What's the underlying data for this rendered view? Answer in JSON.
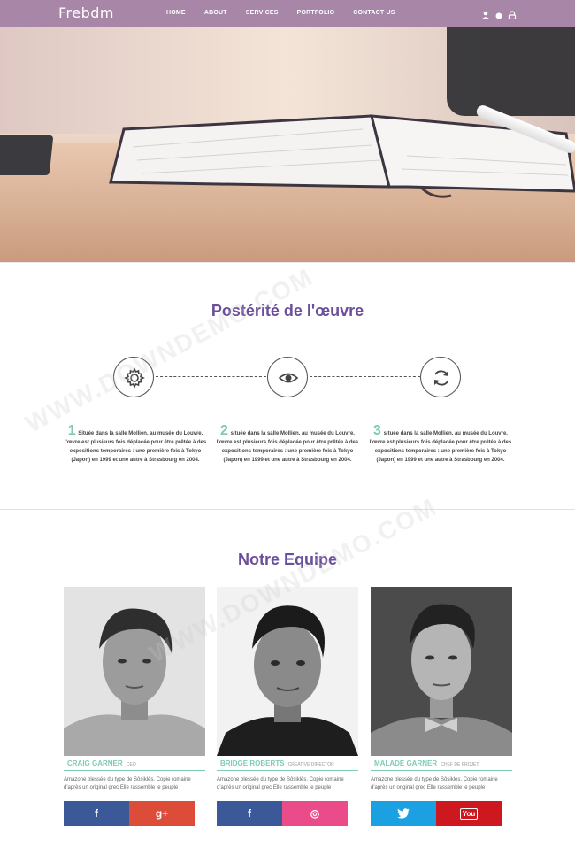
{
  "nav": {
    "logo": "Frebdm",
    "menu": [
      "HOME",
      "ABOUT",
      "SERVICES",
      "PORTFOLIO",
      "CONTACT US"
    ],
    "icons": [
      "user-icon",
      "dot-icon",
      "lock-icon"
    ],
    "bg_color": "#a786a8"
  },
  "hero": {
    "image": "open-notebook-on-desk"
  },
  "process": {
    "title": "Postérité de l'œuvre",
    "icons": [
      "gear-icon",
      "eye-icon",
      "refresh-icon"
    ],
    "steps": [
      {
        "num": "1",
        "text": "Située dans la salle Mollien, au musée du Louvre, l'œvre est plusieurs fois déplacée pour être prêtée à des expositions temporaires : une première fois à Tokyo (Japon) en 1999 et une autre à Strasbourg en 2004."
      },
      {
        "num": "2",
        "text": "située dans la salle Mollien, au musée du Louvre, l'œvre est plusieurs fois déplacée pour être prêtée à des expositions temporaires : une première fois à Tokyo (Japon) en 1999 et une autre à Strasbourg en 2004."
      },
      {
        "num": "3",
        "text": "située dans la salle Mollien, au musée du Louvre, l'œvre est plusieurs fois déplacée pour être prêtée à des expositions temporaires : une première fois à Tokyo (Japon) en 1999 et une autre à Strasbourg en 2004."
      }
    ]
  },
  "team": {
    "title": "Notre Equipe",
    "members": [
      {
        "name": "CRAIG GARNER",
        "role": "CEO",
        "desc": "Amazone blessée du type de Sôsiklès. Copie romaine d'après un original grec Elle rassemble le peuple",
        "socials": [
          {
            "icon": "facebook-icon",
            "label": "f",
            "color": "#3b5998"
          },
          {
            "icon": "google-plus-icon",
            "label": "g+",
            "color": "#dd4b39"
          }
        ]
      },
      {
        "name": "BRIDGE ROBERTS",
        "role": "CREATIVE DIRECTOR",
        "desc": "Amazone blessée du type de Sôsiklès. Copie romaine d'après un original grec Elle rassemble le peuple",
        "socials": [
          {
            "icon": "facebook-icon",
            "label": "f",
            "color": "#3b5998"
          },
          {
            "icon": "dribbble-icon",
            "label": "◎",
            "color": "#ea4c89"
          }
        ]
      },
      {
        "name": "MALADE GARNER",
        "role": "CHEF DE PROJET",
        "desc": "Amazone blessée du type de Sôsiklès. Copie romaine d'après un original grec Elle rassemble le peuple",
        "socials": [
          {
            "icon": "twitter-icon",
            "label": "🐦",
            "color": "#1ba1e2"
          },
          {
            "icon": "youtube-icon",
            "label": "You",
            "color": "#cc181e"
          }
        ]
      }
    ]
  },
  "watermark": "WWW.DOWNDEMO.COM"
}
